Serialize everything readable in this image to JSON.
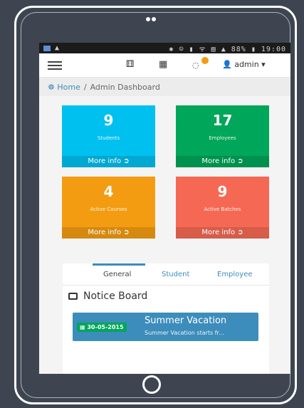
{
  "statusbar": {
    "right_text": "✱ ☺ ▮ ᯤ ▤ ▲ 88% ▮ 19:00"
  },
  "navbar": {
    "admin_label": "admin ▾"
  },
  "breadcrumb": {
    "home": "Home",
    "separator": "/",
    "current": "Admin Dashboard"
  },
  "stats": [
    {
      "value": "9",
      "label": "Students",
      "more": "More info",
      "color": "#00c0ef"
    },
    {
      "value": "17",
      "label": "Employees",
      "more": "More info",
      "color": "#00a65a"
    },
    {
      "value": "4",
      "label": "Active Courses",
      "more": "More info",
      "color": "#f39c12"
    },
    {
      "value": "9",
      "label": "Active Batches",
      "more": "More info",
      "color": "#f56954"
    }
  ],
  "tabs": [
    {
      "label": "General",
      "active": true
    },
    {
      "label": "Student",
      "active": false
    },
    {
      "label": "Employee",
      "active": false
    }
  ],
  "notice_board": {
    "title": "Notice Board",
    "items": [
      {
        "date": "30-05-2015",
        "title": "Summer Vacation",
        "description": "Summer Vacation starts fr..."
      }
    ]
  }
}
